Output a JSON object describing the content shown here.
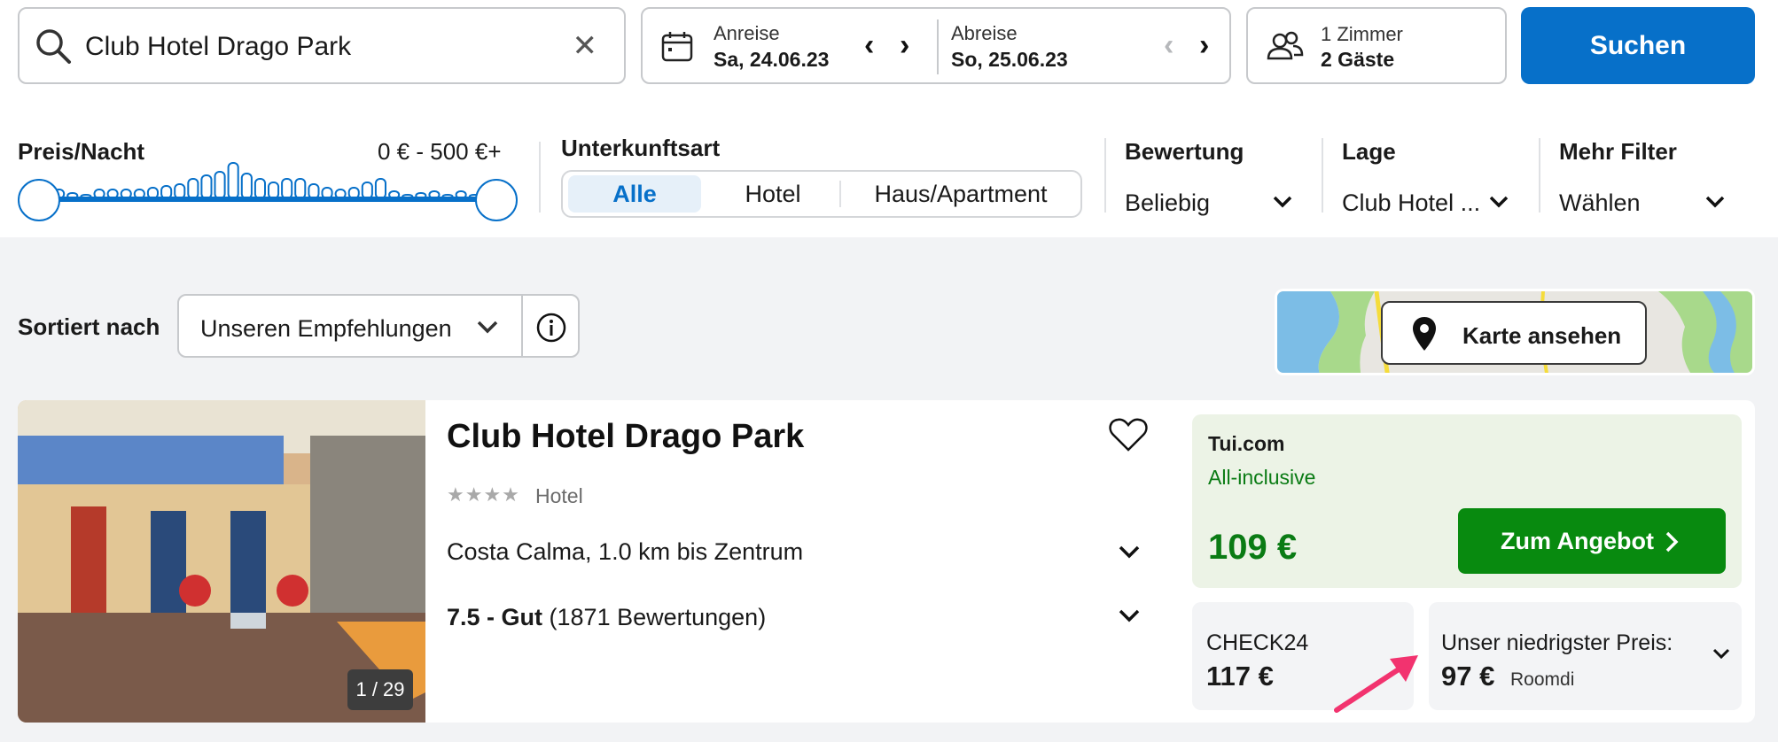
{
  "search": {
    "query": "Club Hotel Drago Park",
    "clear_icon": "close-icon"
  },
  "dates": {
    "checkin_label": "Anreise",
    "checkin_value": "Sa, 24.06.23",
    "checkout_label": "Abreise",
    "checkout_value": "So, 25.06.23"
  },
  "guests": {
    "rooms": "1 Zimmer",
    "people": "2 Gäste"
  },
  "search_button": "Suchen",
  "filters": {
    "price": {
      "label": "Preis/Nacht",
      "range": "0 € - 500 €+",
      "min_fraction": 0.0,
      "max_fraction": 1.0
    },
    "type": {
      "label": "Unterkunftsart",
      "options": [
        "Alle",
        "Hotel",
        "Haus/Apartment"
      ],
      "selected": "Alle"
    },
    "rating": {
      "label": "Bewertung",
      "value": "Beliebig"
    },
    "location": {
      "label": "Lage",
      "value": "Club Hotel ..."
    },
    "more": {
      "label": "Mehr Filter",
      "value": "Wählen"
    }
  },
  "sort": {
    "label": "Sortiert nach",
    "value": "Unseren Empfehlungen"
  },
  "map_button": "Karte ansehen",
  "hotel": {
    "name": "Club Hotel Drago Park",
    "stars": 4,
    "type": "Hotel",
    "location": "Costa Calma, 1.0 km bis Zentrum",
    "rating_score": "7.5 - Gut",
    "rating_count": "(1871 Bewertungen)",
    "photo_counter": "1 / 29",
    "deal": {
      "provider": "Tui.com",
      "board": "All-inclusive",
      "price": "109 €",
      "cta": "Zum Angebot"
    },
    "alt_offer": {
      "provider": "CHECK24",
      "price": "117 €"
    },
    "lowest": {
      "label": "Unser niedrigster Preis:",
      "price": "97 €",
      "provider": "Roomdi"
    }
  },
  "colors": {
    "primary": "#0770c9",
    "deal_green": "#088a0f",
    "price_green": "#0a7b14",
    "highlight_arrow": "#f2336f"
  }
}
